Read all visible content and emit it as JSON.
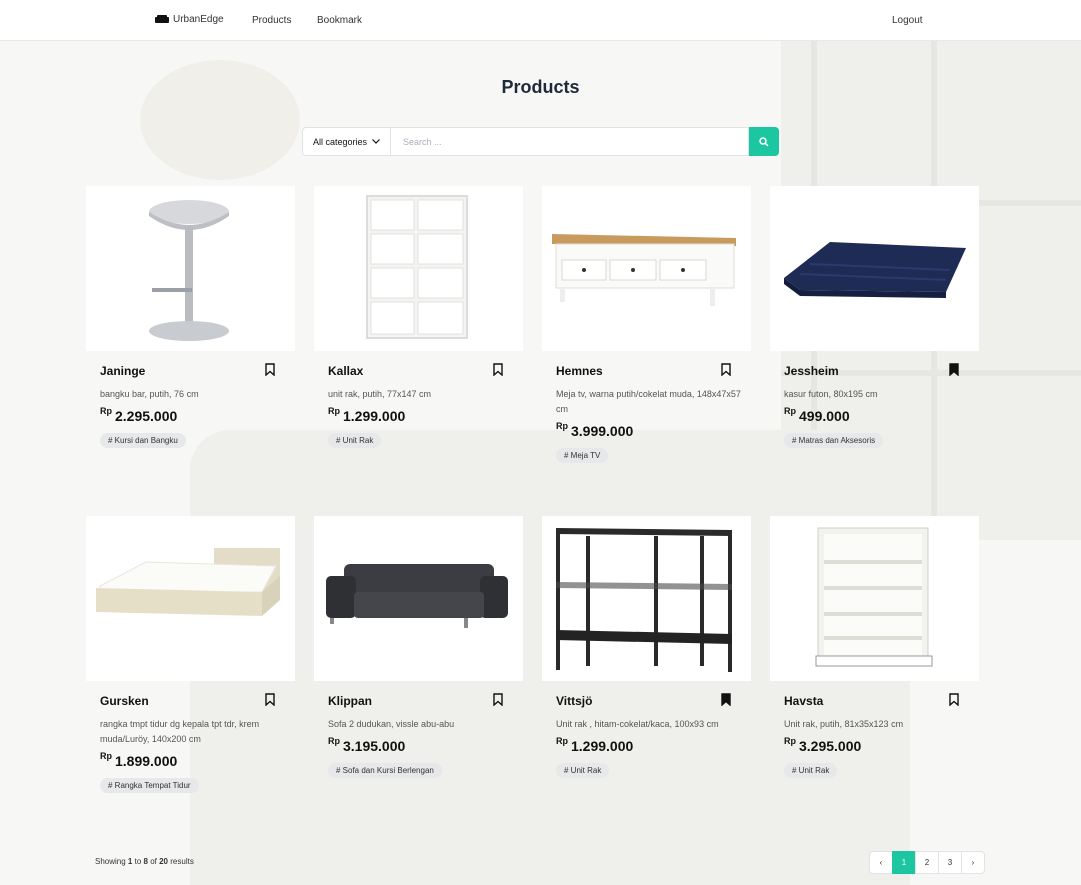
{
  "nav": {
    "brand": "UrbanEdge",
    "links": [
      "Products",
      "Bookmark"
    ],
    "logout": "Logout"
  },
  "page": {
    "title": "Products"
  },
  "search": {
    "category": "All categories",
    "placeholder": "Search ...",
    "value": ""
  },
  "products": [
    {
      "name": "Janinge",
      "desc": "bangku bar, putih, 76 cm",
      "currency": "Rp",
      "price": "2.295.000",
      "tag": "# Kursi dan Bangku",
      "bookmarked": false,
      "image": "bar-stool"
    },
    {
      "name": "Kallax",
      "desc": "unit rak, putih, 77x147 cm",
      "currency": "Rp",
      "price": "1.299.000",
      "tag": "# Unit Rak",
      "bookmarked": false,
      "image": "cube-shelf"
    },
    {
      "name": "Hemnes",
      "desc": "Meja tv, warna putih/cokelat muda, 148x47x57 cm",
      "currency": "Rp",
      "price": "3.999.000",
      "tag": "# Meja TV",
      "bookmarked": false,
      "image": "tv-bench"
    },
    {
      "name": "Jessheim",
      "desc": "kasur futon, 80x195 cm",
      "currency": "Rp",
      "price": "499.000",
      "tag": "# Matras dan Aksesoris",
      "bookmarked": true,
      "image": "futon-mattress"
    },
    {
      "name": "Gursken",
      "desc": "rangka tmpt tidur dg kepala tpt tdr, krem muda/Luröy, 140x200 cm",
      "currency": "Rp",
      "price": "1.899.000",
      "tag": "# Rangka Tempat Tidur",
      "bookmarked": false,
      "image": "bed-frame"
    },
    {
      "name": "Klippan",
      "desc": "Sofa 2 dudukan, vissle abu-abu",
      "currency": "Rp",
      "price": "3.195.000",
      "tag": "# Sofa dan Kursi Berlengan",
      "bookmarked": false,
      "image": "sofa"
    },
    {
      "name": "Vittsjö",
      "desc": "Unit rak , hitam-cokelat/kaca, 100x93 cm",
      "currency": "Rp",
      "price": "1.299.000",
      "tag": "# Unit Rak",
      "bookmarked": true,
      "image": "metal-shelf"
    },
    {
      "name": "Havsta",
      "desc": "Unit rak, putih, 81x35x123 cm",
      "currency": "Rp",
      "price": "3.295.000",
      "tag": "# Unit Rak",
      "bookmarked": false,
      "image": "bookshelf"
    }
  ],
  "footer": {
    "prefix": "Showing",
    "from": "1",
    "to_word": "to",
    "to": "8",
    "of_word": "of",
    "total": "20",
    "suffix": "results"
  },
  "pagination": {
    "prev": "‹",
    "pages": [
      "1",
      "2",
      "3"
    ],
    "active": "1",
    "next": "›"
  },
  "colors": {
    "accent": "#1cc6a0"
  }
}
